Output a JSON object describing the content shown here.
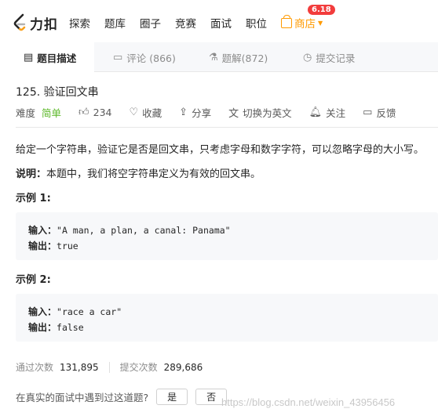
{
  "brand": {
    "name": "力扣",
    "accent": "#ff9a00",
    "logo_color": "#f89f1b"
  },
  "nav": {
    "items": [
      "探索",
      "题库",
      "圈子",
      "竞赛",
      "面试",
      "职位"
    ],
    "shop_label": "商店",
    "shop_badge": "6.18"
  },
  "tabs": [
    {
      "label": "题目描述",
      "icon": "description-icon",
      "active": true
    },
    {
      "label": "评论 (866)",
      "icon": "comment-icon",
      "active": false
    },
    {
      "label": "题解(872)",
      "icon": "flask-icon",
      "active": false
    },
    {
      "label": "提交记录",
      "icon": "clock-icon",
      "active": false
    }
  ],
  "problem": {
    "title": "125. 验证回文串",
    "difficulty_label": "难度",
    "difficulty": "简单",
    "difficulty_color": "#5ab726",
    "likes": "234",
    "favorite_label": "收藏",
    "share_label": "分享",
    "switch_lang_label": "切换为英文",
    "follow_label": "关注",
    "feedback_label": "反馈",
    "description": "给定一个字符串，验证它是否是回文串，只考虑字母和数字字符，可以忽略字母的大小写。",
    "note_label": "说明：",
    "note_text": "本题中，我们将空字符串定义为有效的回文串。"
  },
  "examples": [
    {
      "title": "示例 1:",
      "input_label": "输入",
      "input": "\"A man, a plan, a canal: Panama\"",
      "output_label": "输出",
      "output": "true"
    },
    {
      "title": "示例 2:",
      "input_label": "输入",
      "input": "\"race a car\"",
      "output_label": "输出",
      "output": "false"
    }
  ],
  "stats": {
    "accepted_label": "通过次数",
    "accepted": "131,895",
    "submissions_label": "提交次数",
    "submissions": "289,686"
  },
  "interview": {
    "question": "在真实的面试中遇到过这道题?",
    "yes": "是",
    "no": "否"
  },
  "watermark": "https://blog.csdn.net/weixin_43956456"
}
